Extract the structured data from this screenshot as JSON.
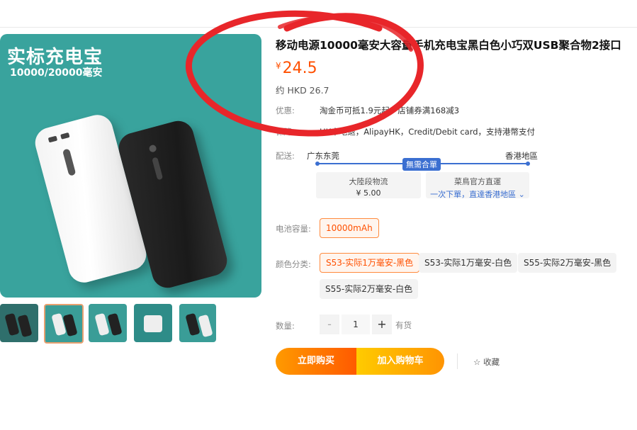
{
  "main_image": {
    "title": "实标充电宝",
    "subtitle": "10000/20000毫安"
  },
  "product": {
    "title": "移动电源10000毫安大容量手机充电宝黑白色小巧双USB聚合物2接口",
    "price_symbol": "¥",
    "price": "24.5",
    "approx_price": "约 HKD 26.7"
  },
  "offers": {
    "label": "优惠:",
    "text": "淘金币可抵1.9元起，店铺券满168减3"
  },
  "guarantee": {
    "label": "保障:",
    "text": "HK本地退，AlipayHK，Credit/Debit card，支持港幣支付"
  },
  "delivery": {
    "label": "配送:",
    "from": "广东东莞",
    "to": "香港地區",
    "badge": "無需合單",
    "leg1_title": "大陸段物流",
    "leg1_value": "¥ 5.00",
    "leg2_title": "菜鳥官方直運",
    "leg2_value": "一次下單，直達香港地區",
    "chevron": "⌄"
  },
  "capacity": {
    "label": "电池容量:",
    "options": [
      "10000mAh"
    ],
    "selected_index": 0
  },
  "color": {
    "label": "颜色分类:",
    "options": [
      "S53-实际1万毫安-黑色",
      "S53-实际1万毫安-白色",
      "S55-实际2万毫安-黑色",
      "S55-实际2万毫安-白色"
    ],
    "selected_index": 0
  },
  "quantity": {
    "label": "数量:",
    "minus": "-",
    "value": "1",
    "plus": "+",
    "stock": "有货"
  },
  "actions": {
    "buy_now": "立即购买",
    "add_to_cart": "加入购物车",
    "favorite_icon": "☆",
    "favorite": "收藏"
  },
  "colors": {
    "accent": "#ff5000",
    "link_blue": "#3b6fd1",
    "image_bg": "#39a39d",
    "annotation_red": "#e8262a"
  }
}
